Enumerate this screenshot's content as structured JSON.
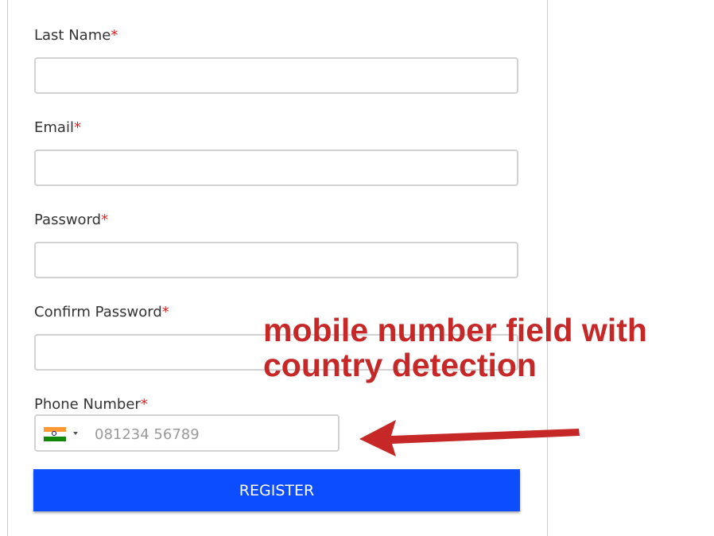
{
  "form": {
    "last_name": {
      "label": "Last Name",
      "required_mark": "*",
      "value": ""
    },
    "email": {
      "label": "Email",
      "required_mark": "*",
      "value": ""
    },
    "password": {
      "label": "Password",
      "required_mark": "*",
      "value": ""
    },
    "confirm_password": {
      "label": "Confirm Password",
      "required_mark": "*",
      "value": ""
    },
    "phone": {
      "label": "Phone Number",
      "required_mark": "*",
      "placeholder": "081234 56789",
      "value": "",
      "country_flag": "india-flag-icon"
    },
    "register_label": "REGISTER"
  },
  "annotation": {
    "text_line1": "mobile number field with",
    "text_line2": "country detection",
    "color": "#c62828",
    "arrow_icon": "left-arrow-icon"
  },
  "colors": {
    "primary_button": "#0b4dff",
    "required_mark": "#e0201f"
  }
}
